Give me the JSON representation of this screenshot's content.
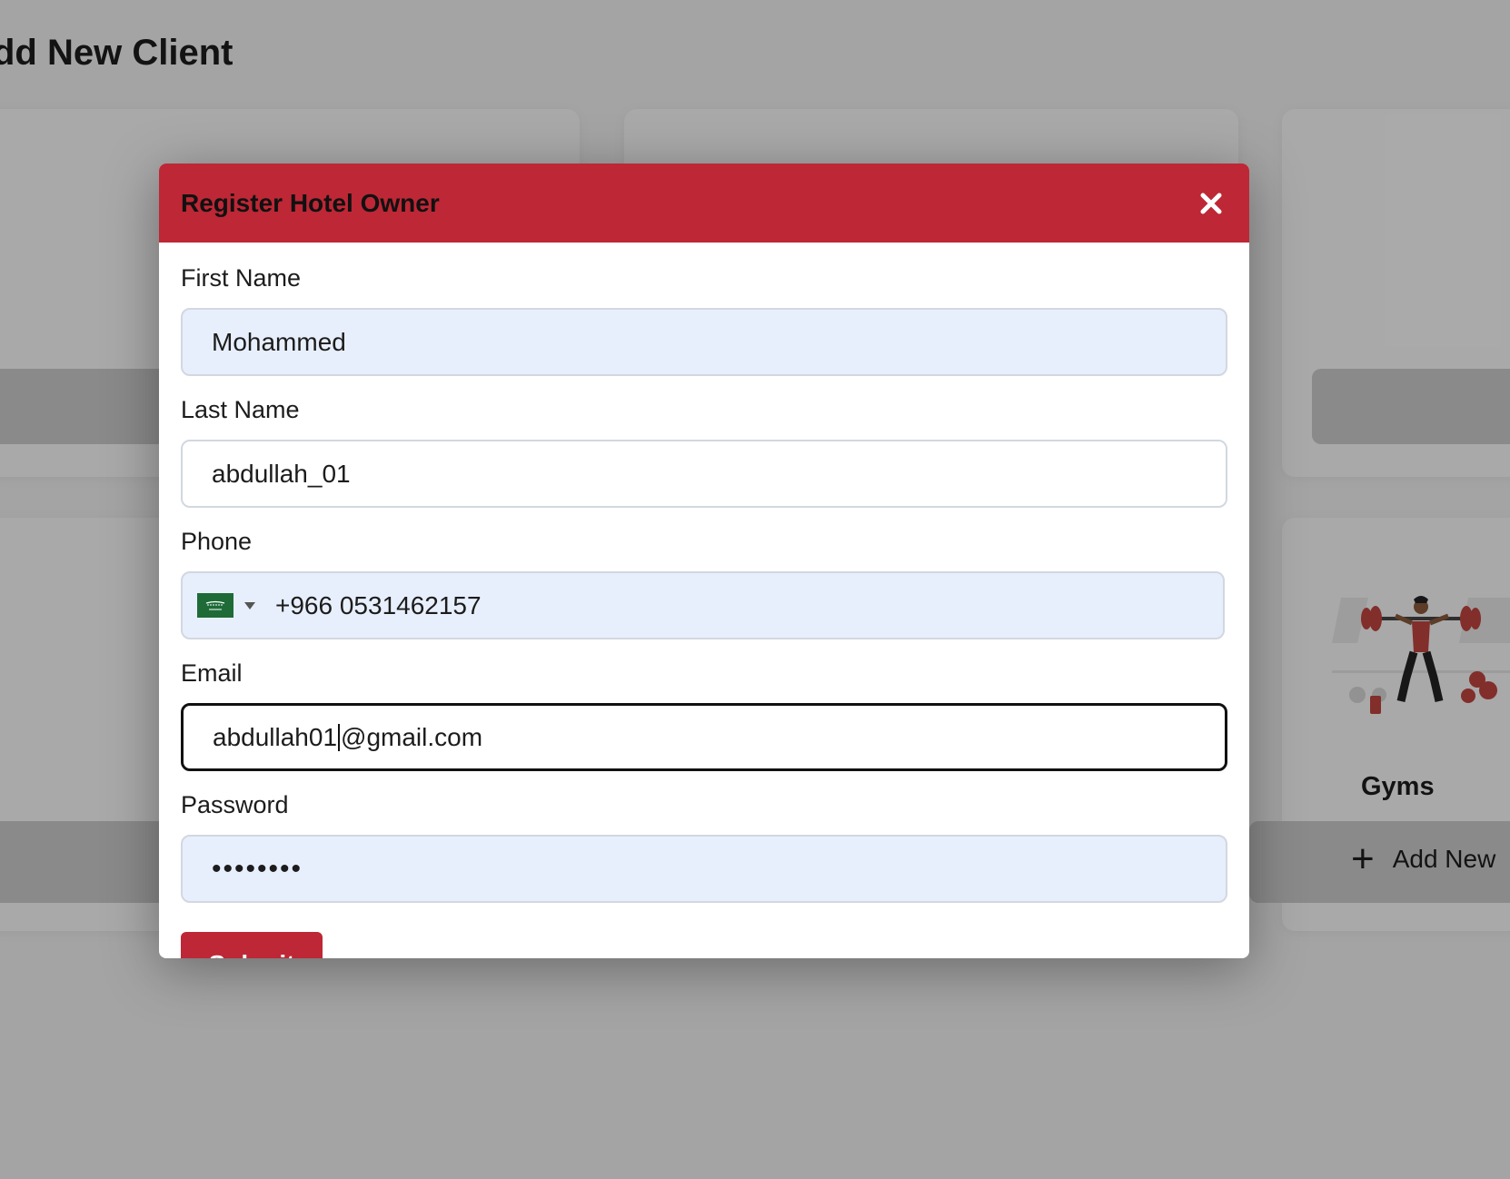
{
  "page": {
    "title": "dd New Client"
  },
  "background": {
    "gyms_card": {
      "label": "Gyms",
      "add_new_label": "Add New",
      "illustration_icon": "weightlifting-illustration-icon"
    }
  },
  "modal": {
    "title": "Register Hotel Owner",
    "close_icon": "close-icon",
    "fields": {
      "first_name": {
        "label": "First Name",
        "value": "Mohammed"
      },
      "last_name": {
        "label": "Last Name",
        "value": "abdullah_01"
      },
      "phone": {
        "label": "Phone",
        "value": "+966 0531462157",
        "country_flag": "saudi-arabia-flag-icon"
      },
      "email": {
        "label": "Email",
        "value_before_caret": "abdullah01",
        "value_after_caret": "@gmail.com"
      },
      "password": {
        "label": "Password",
        "masked_value": "••••••••"
      }
    },
    "submit_label": "Submit"
  },
  "colors": {
    "accent": "#be2735",
    "autofill_bg": "#e8effc",
    "overlay": "rgba(0,0,0,0.32)"
  }
}
